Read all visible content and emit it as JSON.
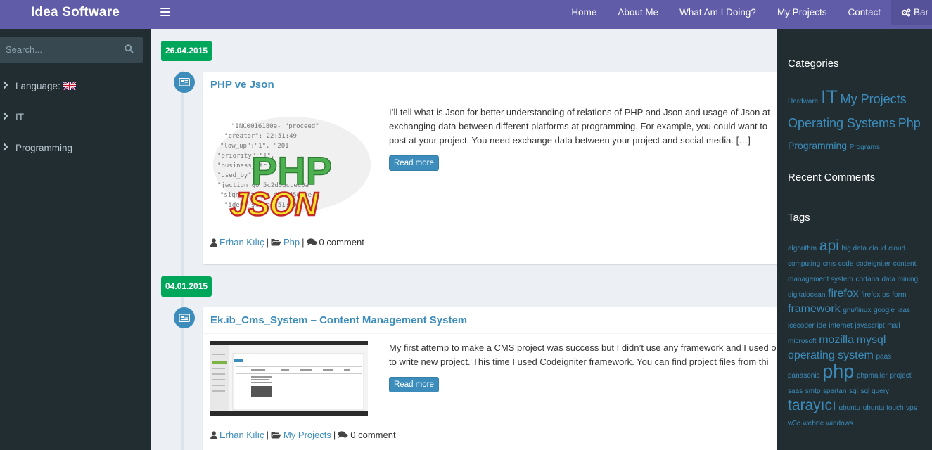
{
  "brand": "Idea Software",
  "nav": {
    "items": [
      "Home",
      "About Me",
      "What Am I Doing?",
      "My Projects",
      "Contact"
    ],
    "bar_label": "Bar"
  },
  "sidebar": {
    "search_placeholder": "Search...",
    "items": [
      {
        "label": "Language:"
      },
      {
        "label": "IT"
      },
      {
        "label": "Programming"
      }
    ]
  },
  "posts": [
    {
      "date": "26.04.2015",
      "title": "PHP ve Json",
      "excerpt_lines": [
        "I’ll tell what is Json for better understanding of relations of PHP and Json and usage of Json at",
        "exchanging data between different platforms at programming. For example, you could want to",
        "post at your project. You need exchange data between your project and social media. […]"
      ],
      "read_more": "Read more",
      "author": "Erhan Kılıç",
      "category": "Php",
      "comments": "0 comment"
    },
    {
      "date": "04.01.2015",
      "title": "Ek.ib_Cms_System – Content Management System",
      "excerpt_lines": [
        "My first attemp to make a CMS project was success but I didn’t use any framework and I used ol",
        "to write new project. This time I used Codeigniter framework. You can find project files from thi"
      ],
      "read_more": "Read more",
      "author": "Erhan Kılıç",
      "category": "My Projects",
      "comments": "0 comment"
    }
  ],
  "right": {
    "categories_title": "Categories",
    "categories": [
      {
        "label": "Hardware",
        "size": 10
      },
      {
        "label": "IT",
        "size": 27
      },
      {
        "label": "My Projects",
        "size": 18
      },
      {
        "label": "Operating Systems",
        "size": 18
      },
      {
        "label": "Php",
        "size": 18
      },
      {
        "label": "Programming",
        "size": 14
      },
      {
        "label": "Programs",
        "size": 10
      }
    ],
    "recent_comments_title": "Recent Comments",
    "tags_title": "Tags",
    "tags": [
      {
        "label": "algorithm",
        "size": 10
      },
      {
        "label": "api",
        "size": 21
      },
      {
        "label": "big data",
        "size": 10
      },
      {
        "label": "cloud",
        "size": 10
      },
      {
        "label": "cloud computing",
        "size": 10
      },
      {
        "label": "cms",
        "size": 10
      },
      {
        "label": "code",
        "size": 10
      },
      {
        "label": "codeigniter",
        "size": 10
      },
      {
        "label": "content management system",
        "size": 10
      },
      {
        "label": "cortana",
        "size": 10
      },
      {
        "label": "data mining",
        "size": 10
      },
      {
        "label": "digitalocean",
        "size": 10
      },
      {
        "label": "firefox",
        "size": 16
      },
      {
        "label": "firefox os",
        "size": 10
      },
      {
        "label": "form",
        "size": 10
      },
      {
        "label": "framework",
        "size": 16
      },
      {
        "label": "gnu/linux",
        "size": 10
      },
      {
        "label": "google",
        "size": 10
      },
      {
        "label": "iaas",
        "size": 10
      },
      {
        "label": "icecoder",
        "size": 10
      },
      {
        "label": "ide",
        "size": 10
      },
      {
        "label": "internet",
        "size": 10
      },
      {
        "label": "javascript",
        "size": 10
      },
      {
        "label": "mail",
        "size": 10
      },
      {
        "label": "microsoft",
        "size": 10
      },
      {
        "label": "mozilla",
        "size": 16
      },
      {
        "label": "mysql",
        "size": 16
      },
      {
        "label": "operating system",
        "size": 16
      },
      {
        "label": "paas",
        "size": 10
      },
      {
        "label": "panasonic",
        "size": 10
      },
      {
        "label": "php",
        "size": 27
      },
      {
        "label": "phpmailer",
        "size": 10
      },
      {
        "label": "project",
        "size": 10
      },
      {
        "label": "saas",
        "size": 10
      },
      {
        "label": "smtp",
        "size": 10
      },
      {
        "label": "spartan",
        "size": 10
      },
      {
        "label": "sql",
        "size": 10
      },
      {
        "label": "sql query",
        "size": 10
      },
      {
        "label": "tarayıcı",
        "size": 21
      },
      {
        "label": "ubuntu",
        "size": 10
      },
      {
        "label": "ubuntu touch",
        "size": 10
      },
      {
        "label": "vps",
        "size": 10
      },
      {
        "label": "w3c",
        "size": 10
      },
      {
        "label": "webrtc",
        "size": 10
      },
      {
        "label": "windows",
        "size": 10
      }
    ]
  },
  "colors": {
    "header": "#605ca8",
    "sidebar": "#222d32",
    "accent": "#3c8dbc",
    "date_badge": "#00a65a"
  },
  "thumb_image_text": [
    "PHP",
    "JSON"
  ]
}
